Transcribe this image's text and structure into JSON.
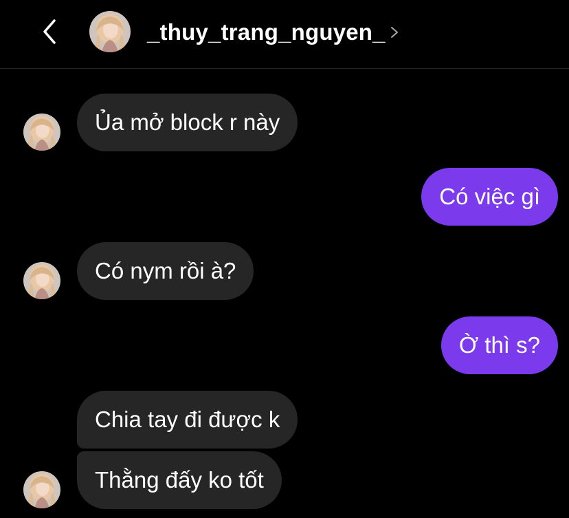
{
  "header": {
    "username": "_thuy_trang_nguyen_",
    "back_icon": "chevron-left-icon",
    "profile_chevron_icon": "chevron-right-icon"
  },
  "colors": {
    "background": "#000000",
    "incoming_bubble": "#262626",
    "outgoing_bubble": "#7b3bed",
    "divider": "#262626"
  },
  "messages": [
    {
      "sender": "them",
      "text": "Ủa mở block r này"
    },
    {
      "sender": "me",
      "text": "Có việc gì"
    },
    {
      "sender": "them",
      "text": "Có nym rồi à?"
    },
    {
      "sender": "me",
      "text": "Ờ thì s?"
    },
    {
      "sender": "them",
      "text": "Chia tay đi được k"
    },
    {
      "sender": "them",
      "text": "Thằng đấy ko tốt"
    }
  ]
}
